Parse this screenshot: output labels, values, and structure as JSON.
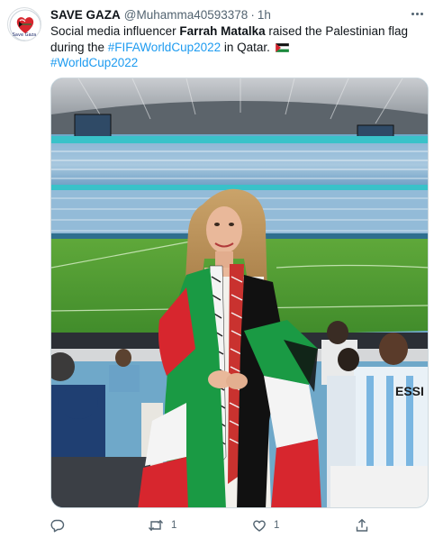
{
  "author": {
    "display_name": "SAVE GAZA",
    "handle": "@Muhamma40593378",
    "separator": "·",
    "time": "1h",
    "avatar_caption": "Save Gaza"
  },
  "tweet": {
    "text_part1": "Social media influencer ",
    "text_bold": "Farrah Matalka",
    "text_part2": " raised the Palestinian flag during the ",
    "hashtag1": "#FIFAWorldCup2022",
    "text_part3": " in Qatar.",
    "hashtag2": "#WorldCup2022"
  },
  "media": {
    "jersey_text": "ESSI"
  },
  "actions": {
    "reply_icon": "reply-icon",
    "retweet_icon": "retweet-icon",
    "retweet_count": "1",
    "like_icon": "heart-icon",
    "like_count": "1",
    "share_icon": "share-icon"
  },
  "colors": {
    "link": "#1d9bf0",
    "secondary_text": "#536471",
    "primary_text": "#0f1419"
  }
}
